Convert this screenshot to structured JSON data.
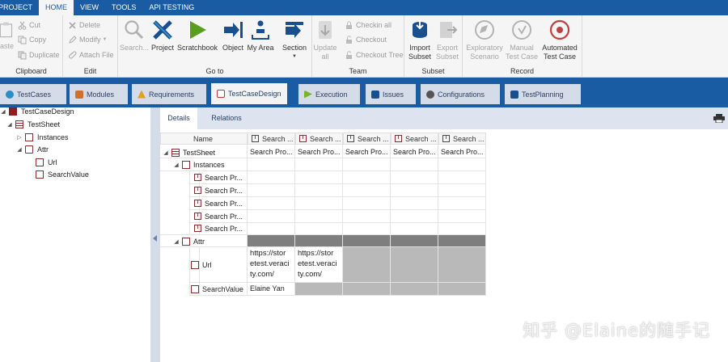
{
  "menubar": {
    "items": [
      "PROJECT",
      "HOME",
      "VIEW",
      "TOOLS",
      "API TESTING"
    ],
    "active": "HOME"
  },
  "ribbon": {
    "clipboard": {
      "paste_label": "aste",
      "cut_label": "Cut",
      "copy_label": "Copy",
      "duplicate_label": "Duplicate",
      "group_label": "Clipboard"
    },
    "edit": {
      "delete_label": "Delete",
      "modify_label": "Modify",
      "attach_label": "Attach File",
      "group_label": "Edit"
    },
    "goto": {
      "search_label": "Search...",
      "project_label": "Project",
      "scratchbook_label": "Scratchbook",
      "object_label": "Object",
      "myarea_label_1": "My Area",
      "section_label": "Section",
      "group_label": "Go to"
    },
    "team": {
      "update_line1": "Update",
      "update_line2": "all",
      "checkin_label": "Checkin all",
      "checkout_label": "Checkout",
      "checkout_tree_label": "Checkout Tree",
      "group_label": "Team"
    },
    "subset": {
      "import_line1": "Import",
      "import_line2": "Subset",
      "export_line1": "Export",
      "export_line2": "Subset",
      "group_label": "Subset"
    },
    "record": {
      "exploratory_line1": "Exploratory",
      "exploratory_line2": "Scenario",
      "manual_line1": "Manual",
      "manual_line2": "Test Case",
      "automated_line1": "Automated",
      "automated_line2": "Test Case",
      "group_label": "Record"
    }
  },
  "doc_tabs": [
    {
      "label": "TestCases",
      "icon": "testcases-icon",
      "color": "#2a8fc7"
    },
    {
      "label": "Modules",
      "icon": "modules-icon",
      "color": "#d0702a"
    },
    {
      "label": "Requirements",
      "icon": "requirements-icon",
      "color": "#e0a020"
    },
    {
      "label": "TestCaseDesign",
      "icon": "testcasedesign-icon",
      "color": "#b23a3a"
    },
    {
      "label": "Execution",
      "icon": "execution-icon",
      "color": "#7ab32e"
    },
    {
      "label": "Issues",
      "icon": "issues-icon",
      "color": "#1a4f8f"
    },
    {
      "label": "Configurations",
      "icon": "configurations-icon",
      "color": "#555555"
    },
    {
      "label": "TestPlanning",
      "icon": "testplanning-icon",
      "color": "#1a4f8f"
    }
  ],
  "tree": {
    "root": "TestCaseDesign",
    "sheet": "TestSheet",
    "instances": "Instances",
    "attr": "Attr",
    "url": "Url",
    "searchvalue": "SearchValue"
  },
  "sub_tabs": {
    "details": "Details",
    "relations": "Relations"
  },
  "grid": {
    "name_header": "Name",
    "col_headers": [
      "Search ...",
      "Search ...",
      "Search ...",
      "Search ...",
      "Search ..."
    ],
    "sheet_label": "TestSheet",
    "sheet_values": [
      "Search Pro...",
      "Search Pro...",
      "Search Pro...",
      "Search Pro...",
      "Search Pro..."
    ],
    "instances_label": "Instances",
    "instance_rows": [
      "Search Pr...",
      "Search Pr...",
      "Search Pr...",
      "Search Pr...",
      "Search Pr..."
    ],
    "attr_label": "Attr",
    "url_label": "Url",
    "url_values": [
      "https://stor etest.veraci ty.com/",
      "https://stor etest.veraci ty.com/"
    ],
    "url_lines": [
      [
        "https://stor",
        "etest.veraci",
        "ty.com/"
      ],
      [
        "https://stor",
        "etest.veraci",
        "ty.com/"
      ]
    ],
    "searchvalue_label": "SearchValue",
    "searchvalue_value": "Elaine Yan"
  },
  "watermark": "知乎 @Elaine的随手记",
  "colors": {
    "menubar": "#1a5ca3",
    "ribbon": "#f5f5f5",
    "tab_inactive": "#d4dcea",
    "accent_red": "#8b2b2b"
  }
}
